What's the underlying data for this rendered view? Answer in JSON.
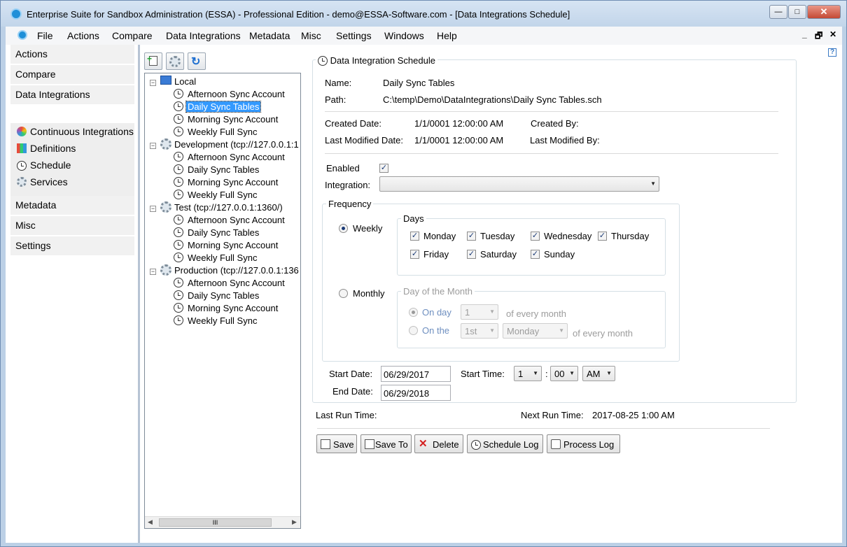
{
  "window": {
    "title": "Enterprise Suite for Sandbox Administration (ESSA) - Professional Edition - demo@ESSA-Software.com - [Data Integrations Schedule]"
  },
  "menubar": {
    "items": [
      "File",
      "Actions",
      "Compare",
      "Data Integrations",
      "Metadata",
      "Misc",
      "Settings",
      "Windows",
      "Help"
    ]
  },
  "leftnav": {
    "categories": [
      "Actions",
      "Compare",
      "Data Integrations",
      "Metadata",
      "Misc",
      "Settings"
    ],
    "subitems": [
      "Continuous Integrations",
      "Definitions",
      "Schedule",
      "Services"
    ]
  },
  "tree": {
    "nodes": [
      {
        "label": "Local",
        "children": [
          "Afternoon Sync Account",
          "Daily Sync Tables",
          "Morning Sync Account",
          "Weekly Full Sync"
        ]
      },
      {
        "label": "Development (tcp://127.0.0.1:1",
        "children": [
          "Afternoon Sync Account",
          "Daily Sync Tables",
          "Morning Sync Account",
          "Weekly Full Sync"
        ]
      },
      {
        "label": "Test (tcp://127.0.0.1:1360/)",
        "children": [
          "Afternoon Sync Account",
          "Daily Sync Tables",
          "Morning Sync Account",
          "Weekly Full Sync"
        ]
      },
      {
        "label": "Production (tcp://127.0.0.1:136",
        "children": [
          "Afternoon Sync Account",
          "Daily Sync Tables",
          "Morning Sync Account",
          "Weekly Full Sync"
        ]
      }
    ],
    "selected": "Local/Daily Sync Tables",
    "scroll_grip": "III"
  },
  "schedule": {
    "group_title": "Data Integration Schedule",
    "name_label": "Name:",
    "name_value": "Daily Sync Tables",
    "path_label": "Path:",
    "path_value": "C:\\temp\\Demo\\DataIntegrations\\Daily Sync Tables.sch",
    "created_date_label": "Created Date:",
    "created_date_value": "1/1/0001 12:00:00 AM",
    "created_by_label": "Created By:",
    "last_modified_date_label": "Last Modified Date:",
    "last_modified_date_value": "1/1/0001 12:00:00 AM",
    "last_modified_by_label": "Last Modified By:",
    "enabled_label": "Enabled",
    "integration_label": "Integration:",
    "integration_value": "",
    "frequency_title": "Frequency",
    "weekly_label": "Weekly",
    "days_title": "Days",
    "days": [
      "Monday",
      "Tuesday",
      "Wednesday",
      "Thursday",
      "Friday",
      "Saturday",
      "Sunday"
    ],
    "monthly_label": "Monthly",
    "day_of_month_title": "Day of the Month",
    "on_day_label": "On day",
    "on_day_value": "1",
    "of_every_month_1": "of every month",
    "on_the_label": "On the",
    "on_the_ordinal": "1st",
    "on_the_weekday": "Monday",
    "of_every_month_2": "of every month",
    "start_date_label": "Start Date:",
    "start_date_value": "06/29/2017",
    "start_time_label": "Start Time:",
    "start_hour": "1",
    "time_sep": ":",
    "start_minute": "00",
    "start_ampm": "AM",
    "end_date_label": "End Date:",
    "end_date_value": "06/29/2018",
    "last_run_label": "Last Run Time:",
    "last_run_value": "",
    "next_run_label": "Next Run Time:",
    "next_run_value": "2017-08-25 1:00 AM"
  },
  "buttons": {
    "save": "Save",
    "save_to": "Save To",
    "delete": "Delete",
    "schedule_log": "Schedule Log",
    "process_log": "Process Log"
  },
  "colors": {
    "selection": "#3399ff",
    "accent": "#1e8fd8",
    "titlebar": "#c8d9ee"
  }
}
